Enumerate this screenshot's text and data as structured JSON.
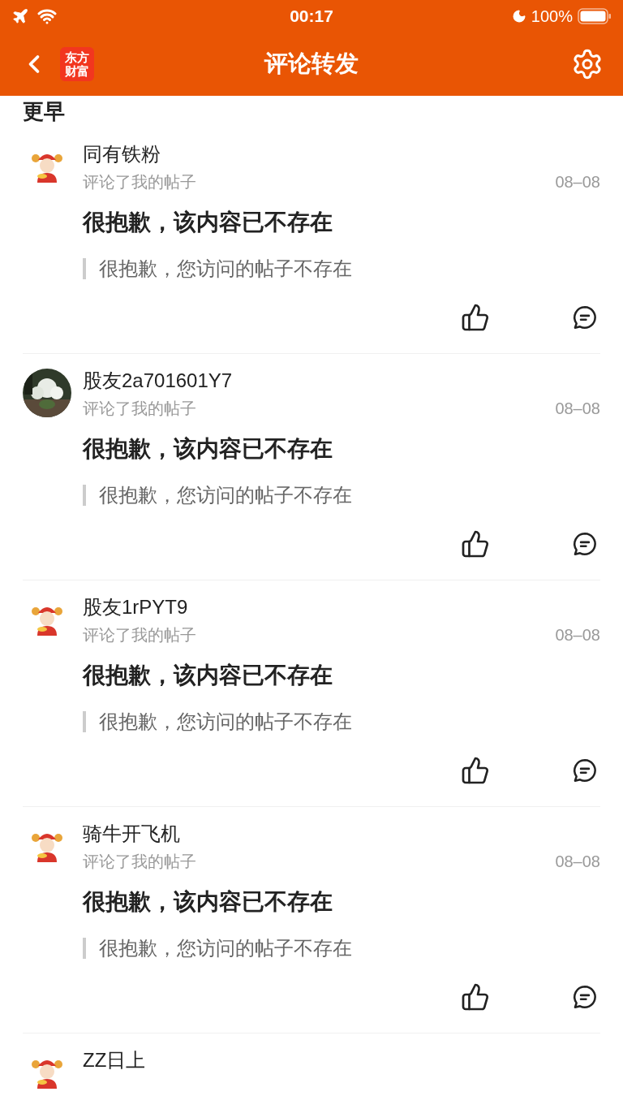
{
  "status_bar": {
    "time": "00:17",
    "battery": "100%"
  },
  "nav": {
    "logo": "东方财富",
    "title": "评论转发"
  },
  "section": "更早",
  "items": [
    {
      "avatar": {
        "kind": "mascot"
      },
      "name": "同有铁粉",
      "action": "评论了我的帖子",
      "date": "08–08",
      "title": "很抱歉，该内容已不存在",
      "quote": "很抱歉，您访问的帖子不存在"
    },
    {
      "name": "股友2a701601Y7",
      "action": "评论了我的帖子",
      "date": "08–08",
      "title": "很抱歉，该内容已不存在",
      "quote": "很抱歉，您访问的帖子不存在"
    },
    {
      "avatar": {
        "kind": "mascot"
      },
      "name": "股友1rPYT9",
      "action": "评论了我的帖子",
      "date": "08–08",
      "title": "很抱歉，该内容已不存在",
      "quote": "很抱歉，您访问的帖子不存在"
    },
    {
      "avatar": {
        "kind": "mascot"
      },
      "name": "骑牛开飞机",
      "action": "评论了我的帖子",
      "date": "08–08",
      "title": "很抱歉，该内容已不存在",
      "quote": "很抱歉，您访问的帖子不存在"
    },
    {
      "avatar": {
        "kind": "mascot"
      },
      "name": "ZZ日上"
    }
  ]
}
